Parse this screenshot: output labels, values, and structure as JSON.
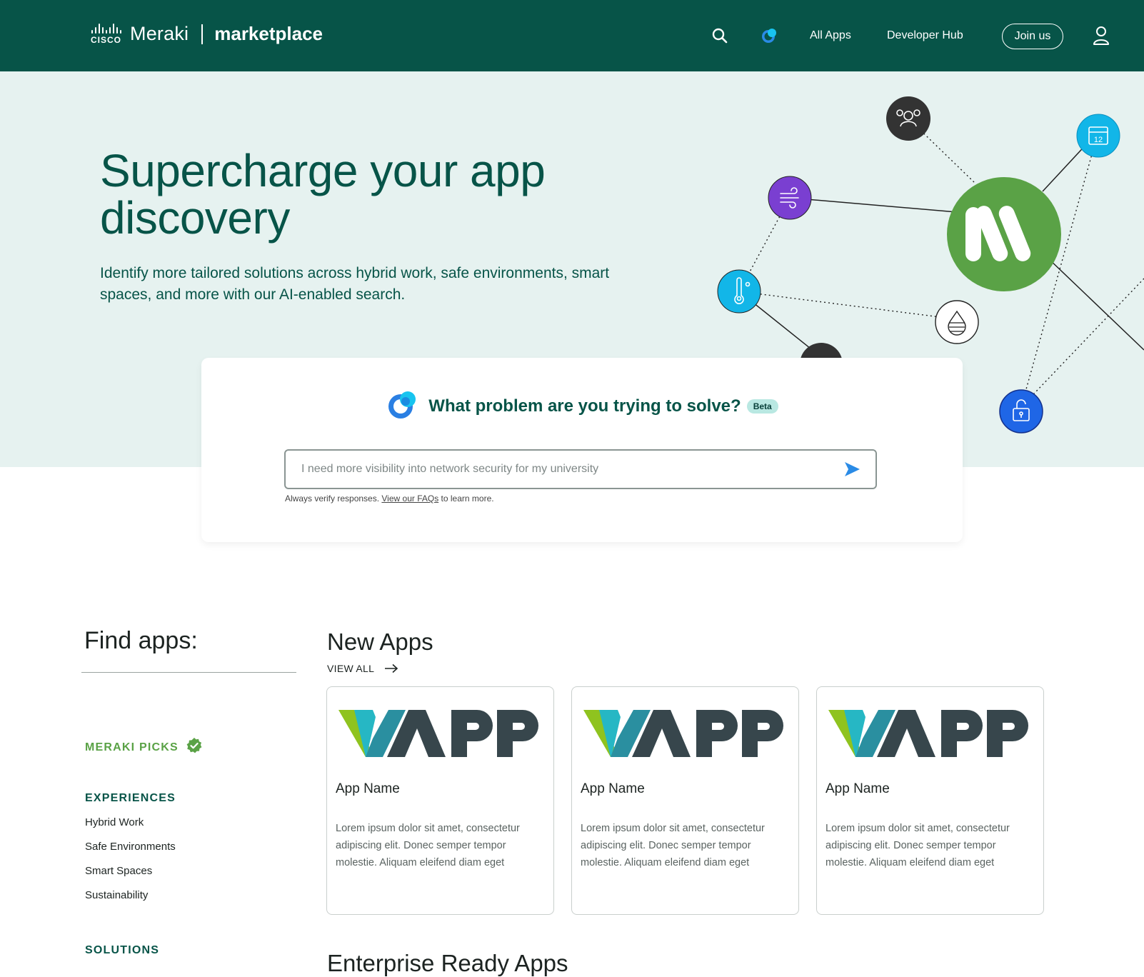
{
  "header": {
    "cisco_text": "CISCO",
    "meraki_text": "Meraki",
    "marketplace_text": "marketplace",
    "nav": [
      "All Apps",
      "Developer Hub"
    ],
    "join_label": "Join us",
    "icons": [
      "search-icon",
      "ai-assistant-icon",
      "user-icon"
    ]
  },
  "hero": {
    "title": "Supercharge your app discovery",
    "subtitle": "Identify more tailored solutions across hybrid work, safe environments, smart spaces, and more with our AI-enabled search."
  },
  "search": {
    "question": "What problem are you trying to solve?",
    "badge": "Beta",
    "placeholder": "I need more visibility into network security for my university",
    "disclaimer_before": "Always verify responses.",
    "disclaimer_link": "View our FAQs",
    "disclaimer_after": "to learn more."
  },
  "sidebar": {
    "title": "Find apps:",
    "picks_label": "MERAKI PICKS",
    "experiences_label": "EXPERIENCES",
    "experiences": [
      "Hybrid Work",
      "Safe Environments",
      "Smart Spaces",
      "Sustainability"
    ],
    "solutions_label": "SOLUTIONS"
  },
  "new_apps": {
    "title": "New Apps",
    "view_all": "VIEW ALL",
    "cards": [
      {
        "logo_text": "VAPP",
        "name": "App Name",
        "description": "Lorem ipsum dolor sit amet, consectetur adipiscing elit. Donec semper tempor molestie. Aliquam eleifend diam eget"
      },
      {
        "logo_text": "VAPP",
        "name": "App Name",
        "description": "Lorem ipsum dolor sit amet, consectetur adipiscing elit. Donec semper tempor molestie. Aliquam eleifend diam eget"
      },
      {
        "logo_text": "VAPP",
        "name": "App Name",
        "description": "Lorem ipsum dolor sit amet, consectetur adipiscing elit. Donec semper tempor molestie. Aliquam eleifend diam eget"
      }
    ]
  },
  "next_section_title": "Enterprise Ready Apps",
  "colors": {
    "header_bg": "#075448",
    "hero_bg": "#e6f2f0",
    "brand_green": "#075448",
    "picks_green": "#5aa246",
    "meraki_logo_green": "#5aa246",
    "node_cyan": "#12b6e8",
    "node_purple": "#7a3fd1",
    "node_blue": "#1f66e6",
    "node_dark": "#333333"
  }
}
